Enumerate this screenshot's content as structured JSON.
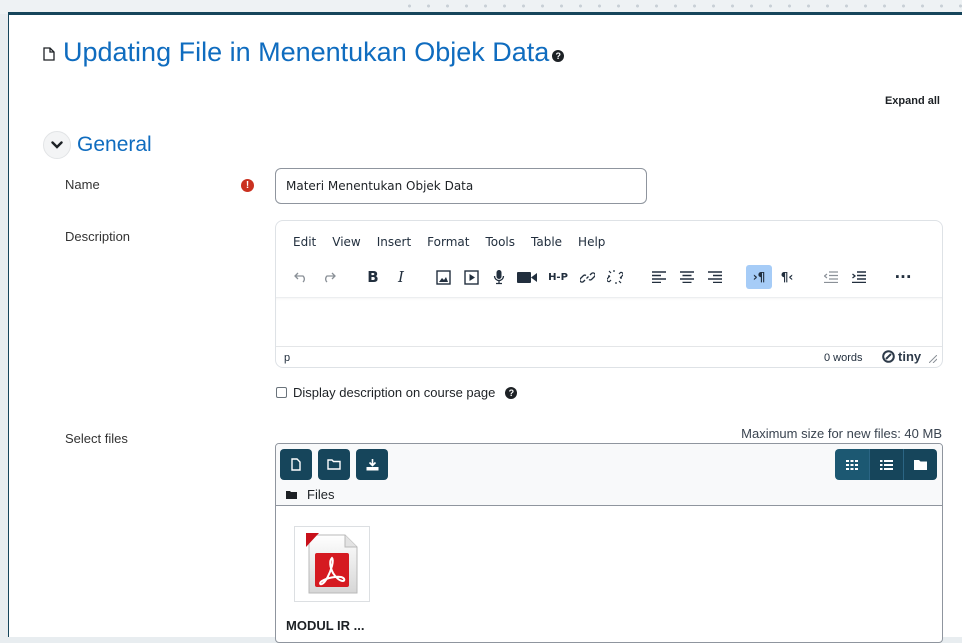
{
  "page": {
    "title": "Updating File in Menentukan Objek Data",
    "expand_all": "Expand all",
    "accent_color": "#0f6cbf",
    "primary_dark": "#16455b"
  },
  "general": {
    "section_title": "General",
    "name_label": "Name",
    "name_value": "Materi Menentukan Objek Data",
    "description_label": "Description"
  },
  "editor": {
    "menus": [
      "Edit",
      "View",
      "Insert",
      "Format",
      "Tools",
      "Table",
      "Help"
    ],
    "status_path": "p",
    "word_count": "0 words",
    "brand": "tiny"
  },
  "display_option": {
    "label": "Display description on course page",
    "checked": false
  },
  "files": {
    "label": "Select files",
    "max_size": "Maximum size for new files: 40 MB",
    "folder_label": "Files",
    "items": [
      {
        "name": "MODUL IR ...",
        "icon": "pdf-file-icon"
      }
    ]
  }
}
